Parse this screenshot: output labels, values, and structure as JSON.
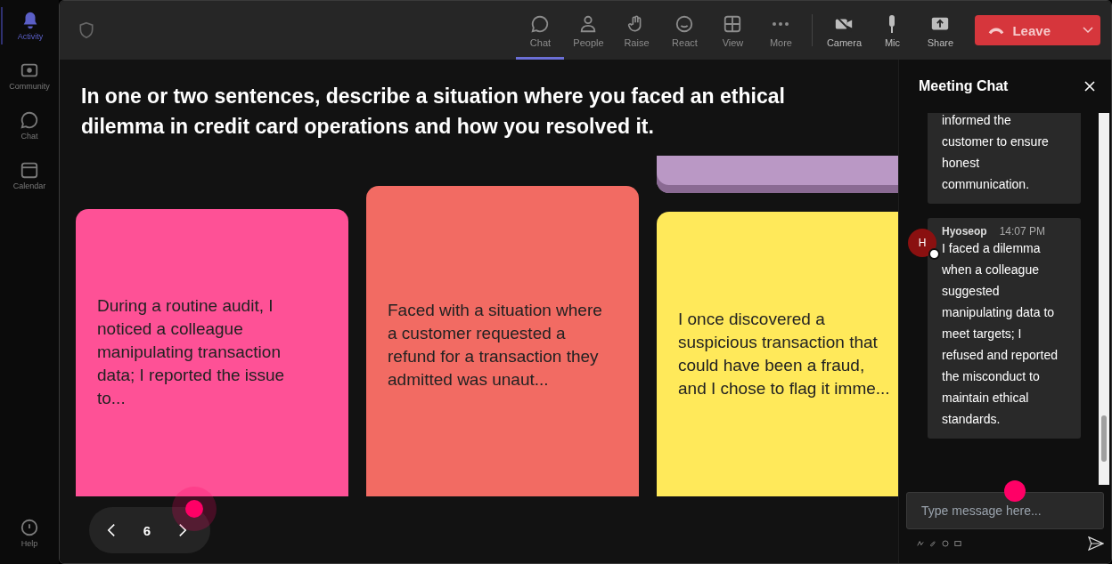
{
  "sidebar": {
    "items": [
      {
        "label": "Activity",
        "kind": "bell",
        "selected": true
      },
      {
        "label": "Community",
        "kind": "community",
        "selected": false
      },
      {
        "label": "Chat",
        "kind": "chat",
        "selected": false
      },
      {
        "label": "Calendar",
        "kind": "calendar",
        "selected": false
      }
    ],
    "help": {
      "label": "Help"
    }
  },
  "toolbar": {
    "items": [
      {
        "label": "Chat",
        "kind": "chat",
        "selected": true
      },
      {
        "label": "People",
        "kind": "person",
        "selected": false
      },
      {
        "label": "Raise",
        "kind": "hand",
        "selected": false
      },
      {
        "label": "React",
        "kind": "smile",
        "selected": false
      },
      {
        "label": "View",
        "kind": "grid",
        "selected": false
      },
      {
        "label": "More",
        "kind": "dots",
        "selected": false
      }
    ],
    "devices": [
      {
        "label": "Camera",
        "kind": "camera"
      },
      {
        "label": "Mic",
        "kind": "mic"
      },
      {
        "label": "Share",
        "kind": "share"
      }
    ],
    "leave": {
      "label": "Leave"
    }
  },
  "prompt": "In one or two sentences, describe a situation where you faced an ethical dilemma in credit card operations and how you resolved it.",
  "columns": [
    [
      {
        "text": "During a routine audit, I\nnoticed a colleague\nmanipulating transaction\ndata; I reported the issue\nto...",
        "color": "#fe5196"
      }
    ],
    [
      {
        "text": "Faced with a situation where\na customer requested a\nrefund for a transaction they\nadmitted was unaut...",
        "color": "#f26b63"
      }
    ],
    [
      {
        "color": "#ba98c5"
      },
      {
        "text": "I once discovered a\nsuspicious transaction that\ncould have been a fraud,\nand I chose to flag it imme...",
        "color": "#ffe95a"
      }
    ]
  ],
  "pager": {
    "page": "6"
  },
  "chat": {
    "title": "Meeting Chat",
    "messages": [
      {
        "text": "informed the customer to ensure honest communication."
      },
      {
        "author": "Hyoseop",
        "avatar": "H",
        "time": "14:07 PM",
        "text": "I faced a dilemma when a colleague suggested manipulating data to meet targets; I refused and reported the misconduct to maintain ethical standards."
      }
    ],
    "input": {
      "placeholder": "Type message here..."
    }
  }
}
